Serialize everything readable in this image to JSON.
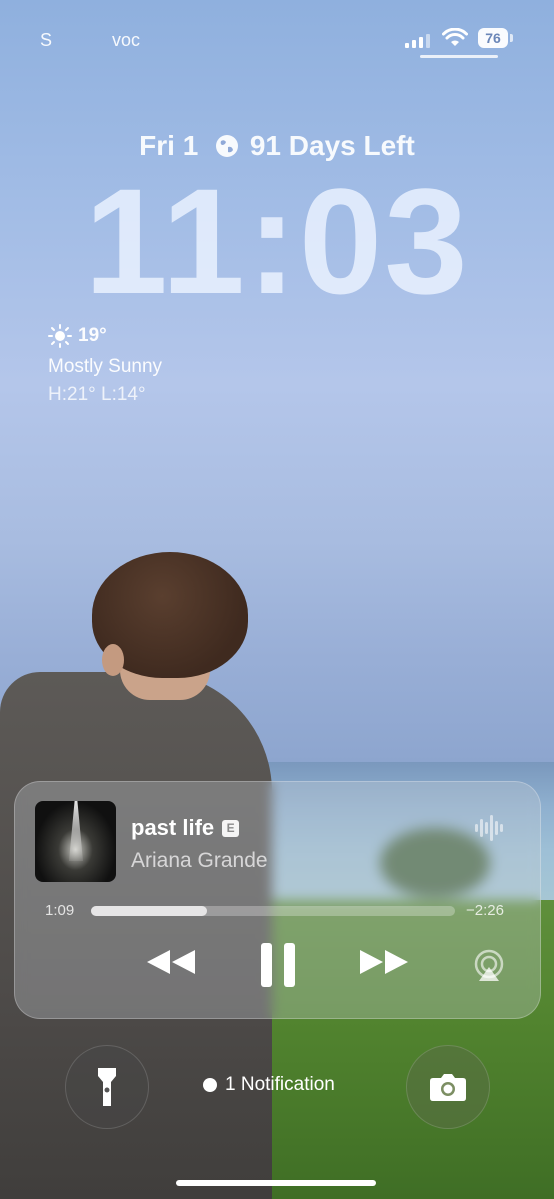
{
  "status_bar": {
    "carrier_left": "S",
    "carrier_right": "voc",
    "battery": "76"
  },
  "lockscreen": {
    "date": "Fri 1",
    "countdown": "91 Days Left",
    "time": "11:03"
  },
  "weather": {
    "temp": "19°",
    "condition": "Mostly Sunny",
    "high_low": "H:21° L:14°",
    "icon": "sun-icon"
  },
  "now_playing": {
    "title": "past life",
    "explicit_badge": "E",
    "artist": "Ariana Grande",
    "elapsed": "1:09",
    "remaining": "−2:26",
    "progress": 0.32
  },
  "bottom": {
    "notification": "1 Notification"
  }
}
